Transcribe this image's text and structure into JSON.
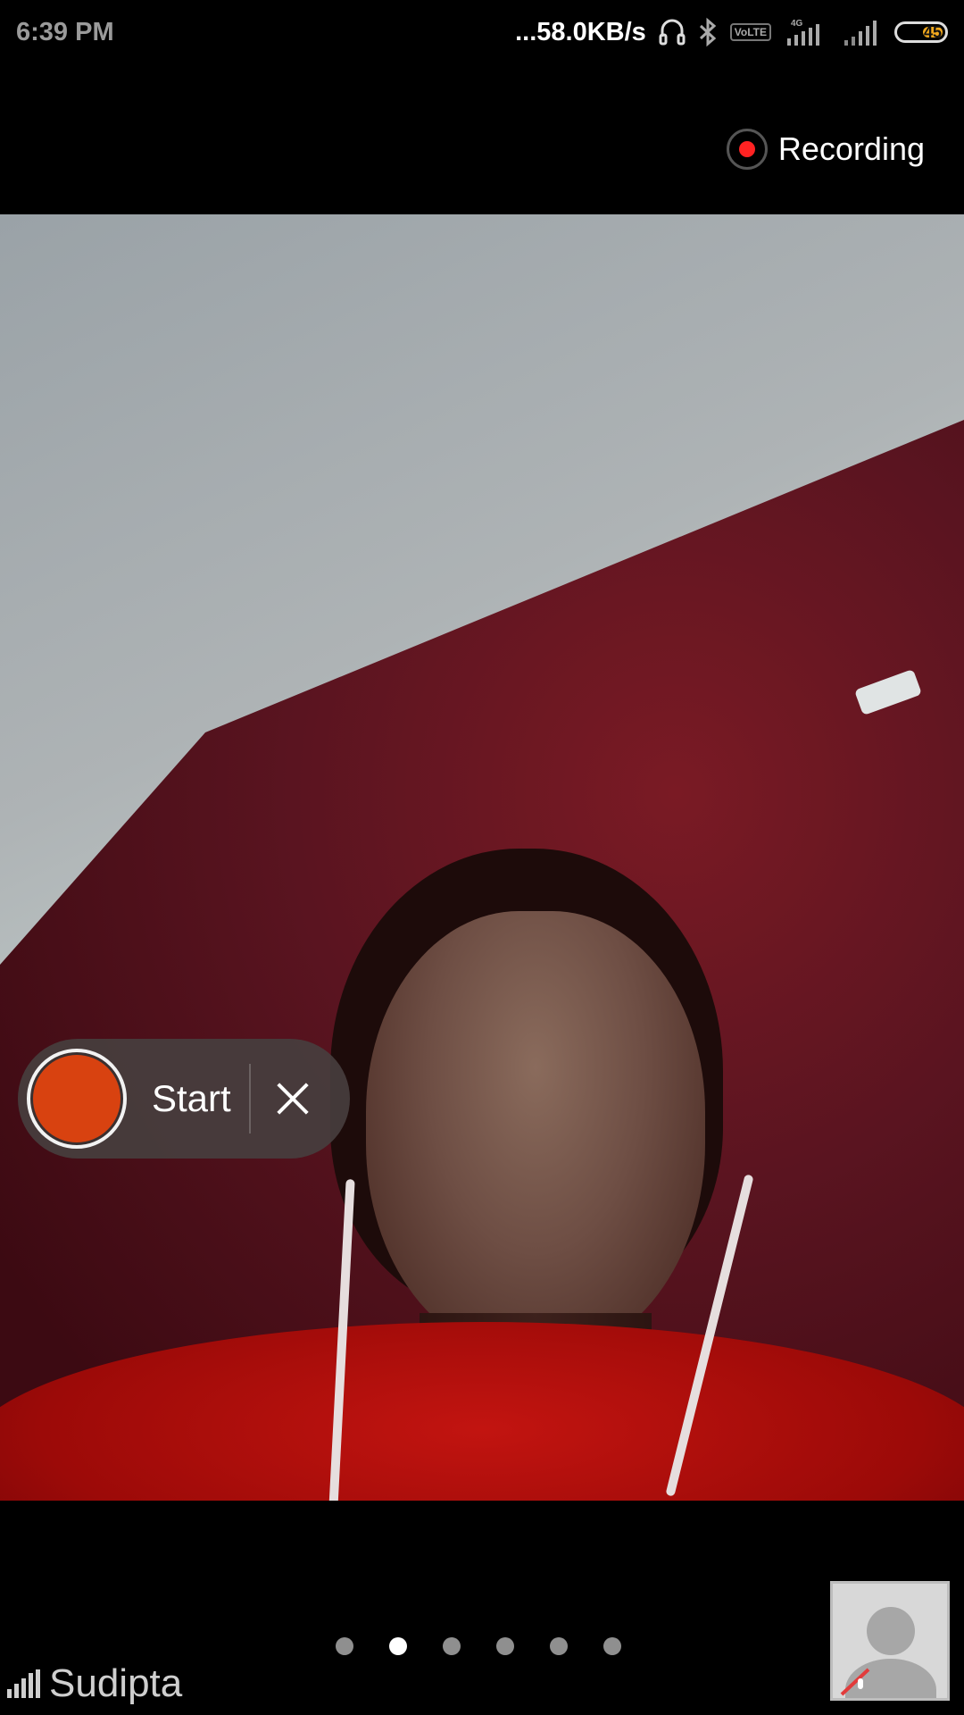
{
  "status_bar": {
    "time": "6:39 PM",
    "network_speed": "...58.0KB/s",
    "volte_label": "VoLTE",
    "network_type": "4G",
    "battery_level": "45",
    "icons": [
      "headset-icon",
      "bluetooth-icon",
      "volte-icon",
      "signal-icon",
      "signal-icon",
      "battery-icon"
    ]
  },
  "recording": {
    "label": "Recording",
    "indicator_color": "#ff2222"
  },
  "start_control": {
    "label": "Start",
    "button_color": "#d84210"
  },
  "pager": {
    "count": 6,
    "active_index": 1
  },
  "participant": {
    "name": "Sudipta"
  },
  "colors": {
    "background": "#000000",
    "active_dot": "#ffffff",
    "inactive_dot": "#8f8f8f"
  }
}
